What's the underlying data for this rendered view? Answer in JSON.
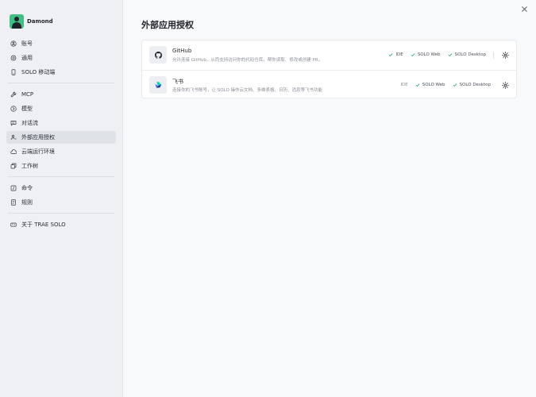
{
  "user": {
    "name": "Damond"
  },
  "sidebar": {
    "groups": [
      [
        {
          "label": "账号",
          "icon": "user-circle-icon"
        },
        {
          "label": "通用",
          "icon": "gear-icon"
        },
        {
          "label": "SOLO 移动端",
          "icon": "mobile-icon"
        }
      ],
      [
        {
          "label": "MCP",
          "icon": "wrench-icon"
        },
        {
          "label": "模型",
          "icon": "model-icon"
        },
        {
          "label": "对话流",
          "icon": "chat-icon"
        },
        {
          "label": "外部应用授权",
          "icon": "person-link-icon",
          "active": true
        },
        {
          "label": "云端运行环境",
          "icon": "cloud-icon"
        },
        {
          "label": "工作树",
          "icon": "worktree-icon"
        }
      ],
      [
        {
          "label": "命令",
          "icon": "command-icon"
        },
        {
          "label": "规则",
          "icon": "rules-icon"
        }
      ],
      [
        {
          "label": "关于 TRAE SOLO",
          "icon": "trae-icon"
        }
      ]
    ]
  },
  "main": {
    "title": "外部应用授权",
    "apps": [
      {
        "name": "GitHub",
        "description": "允许连接 GitHub，从而支持访问你的代码仓库，帮你读取、修改或创建 PR。",
        "icon": "github-icon",
        "tags": [
          {
            "label": "IDE",
            "checked": true
          },
          {
            "label": "SOLO Web",
            "checked": true
          },
          {
            "label": "SOLO Desktop",
            "checked": true
          }
        ]
      },
      {
        "name": "飞书",
        "description": "连接你的飞书账号，让 SOLO 操作云文档、多维表格、日历、消息等飞书功能",
        "icon": "feishu-icon",
        "tags": [
          {
            "label": "IDE",
            "checked": false
          },
          {
            "label": "SOLO Web",
            "checked": true
          },
          {
            "label": "SOLO Desktop",
            "checked": true
          }
        ]
      }
    ]
  },
  "colors": {
    "accent": "#3fbf86",
    "check": "#2fa86f",
    "sidebar_bg": "#eef0f3",
    "main_bg": "#f8f9fb"
  }
}
